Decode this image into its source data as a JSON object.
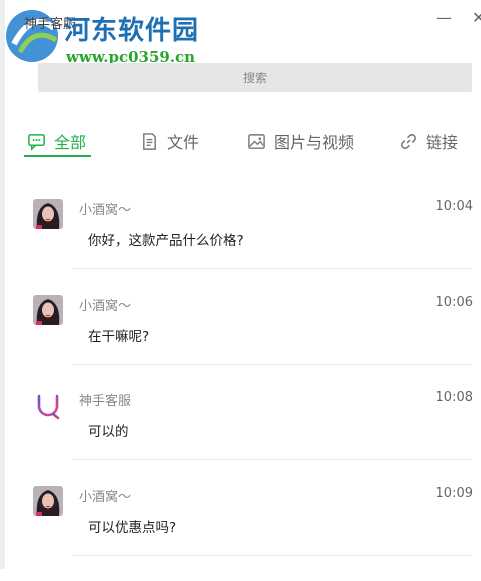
{
  "window": {
    "title": "神手客服",
    "minimize_glyph": "—",
    "close_glyph": "✕"
  },
  "watermark": {
    "site_name": "河东软件园",
    "url": "www.pc0359.cn"
  },
  "search": {
    "placeholder": "搜索"
  },
  "tabs": [
    {
      "label": "全部",
      "icon": "chat-bubble-icon",
      "active": true
    },
    {
      "label": "文件",
      "icon": "document-icon",
      "active": false
    },
    {
      "label": "图片与视频",
      "icon": "image-icon",
      "active": false
    },
    {
      "label": "链接",
      "icon": "link-icon",
      "active": false
    }
  ],
  "messages": [
    {
      "sender": "小酒窝～",
      "time": "10:04",
      "text": "你好，这款产品什么价格?",
      "avatar": "user-photo"
    },
    {
      "sender": "小酒窝～",
      "time": "10:06",
      "text": "在干嘛呢?",
      "avatar": "user-photo"
    },
    {
      "sender": "神手客服",
      "time": "10:08",
      "text": "可以的",
      "avatar": "hand-logo"
    },
    {
      "sender": "小酒窝～",
      "time": "10:09",
      "text": "可以优惠点吗?",
      "avatar": "user-photo"
    }
  ],
  "colors": {
    "accent": "#1fb545",
    "search_bg": "#e6e6e6",
    "brand_logo_gradient": [
      "#7b4dd6",
      "#e2457f"
    ]
  }
}
